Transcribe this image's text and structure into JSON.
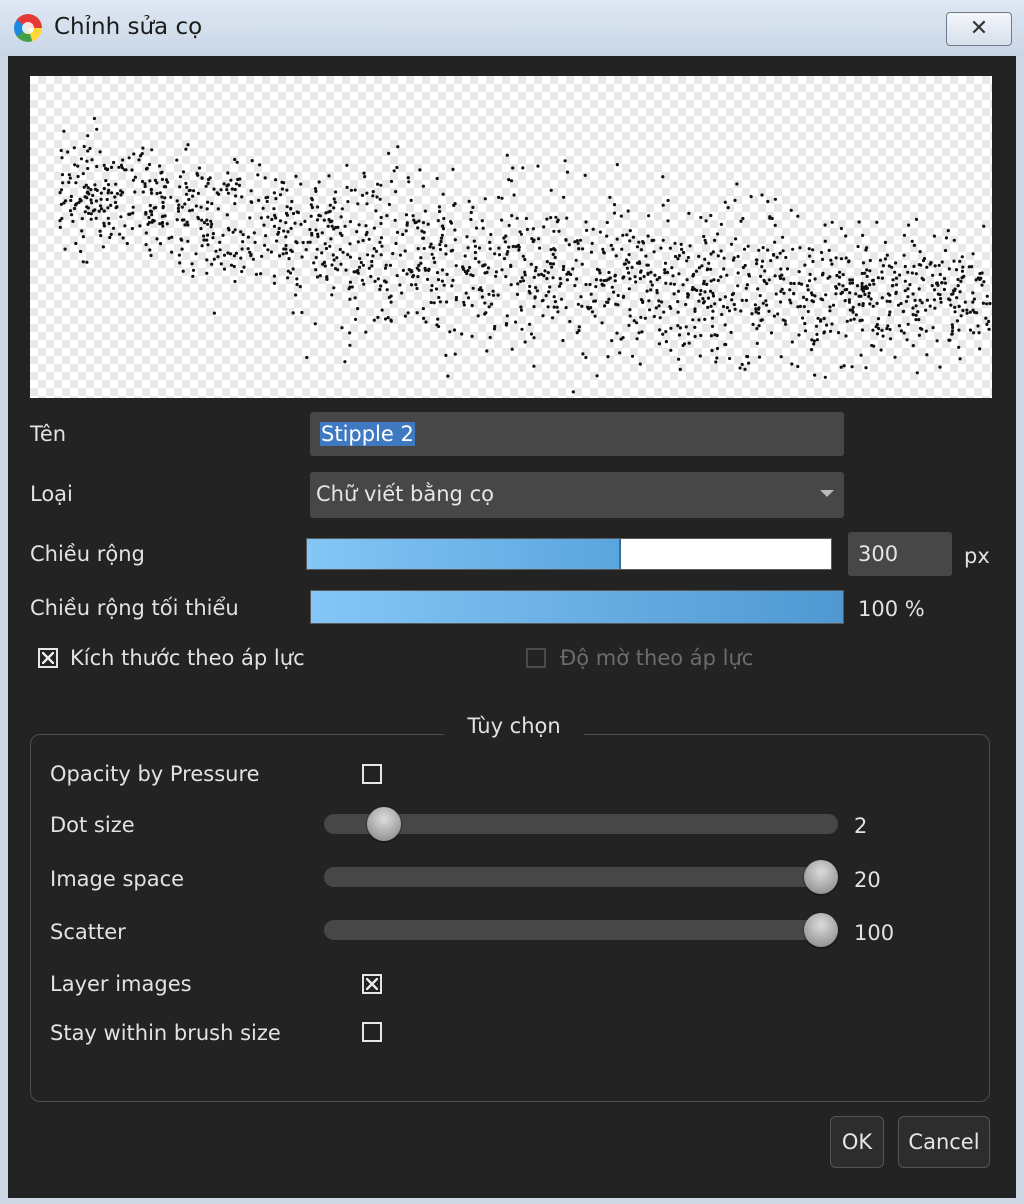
{
  "window": {
    "title": "Chỉnh sửa cọ",
    "icon": "app-color-wheel-icon",
    "close_icon": "close-icon"
  },
  "preview": {
    "description_icon": "brush-stroke-preview"
  },
  "form": {
    "name_label": "Tên",
    "name_value": "Stipple 2",
    "type_label": "Loại",
    "type_value": "Chữ viết bằng cọ",
    "width_label": "Chiều rộng",
    "width_value": "300",
    "width_unit": "px",
    "width_fraction": 0.6,
    "min_width_label": "Chiều rộng tối thiểu",
    "min_width_value": "100 %",
    "min_width_fraction": 1.0,
    "size_pressure_label": "Kích thước theo áp lực",
    "size_pressure_checked": true,
    "opacity_pressure_label": "Độ mờ theo áp lực",
    "opacity_pressure_checked": false,
    "opacity_pressure_enabled": false
  },
  "options": {
    "title": "Tùy chọn",
    "opacity_by_pressure_label": "Opacity by Pressure",
    "opacity_by_pressure_checked": false,
    "dot_size_label": "Dot size",
    "dot_size_value": "2",
    "dot_size_fraction": 0.09,
    "image_space_label": "Image space",
    "image_space_value": "20",
    "image_space_fraction": 1.0,
    "scatter_label": "Scatter",
    "scatter_value": "100",
    "scatter_fraction": 1.0,
    "layer_images_label": "Layer images",
    "layer_images_checked": true,
    "stay_within_label": "Stay within brush size",
    "stay_within_checked": false
  },
  "buttons": {
    "ok_label": "OK",
    "cancel_label": "Cancel"
  },
  "colors": {
    "dialog_bg": "#232323",
    "accent_blue": "#5aa5de",
    "selection": "#3e79c2"
  }
}
